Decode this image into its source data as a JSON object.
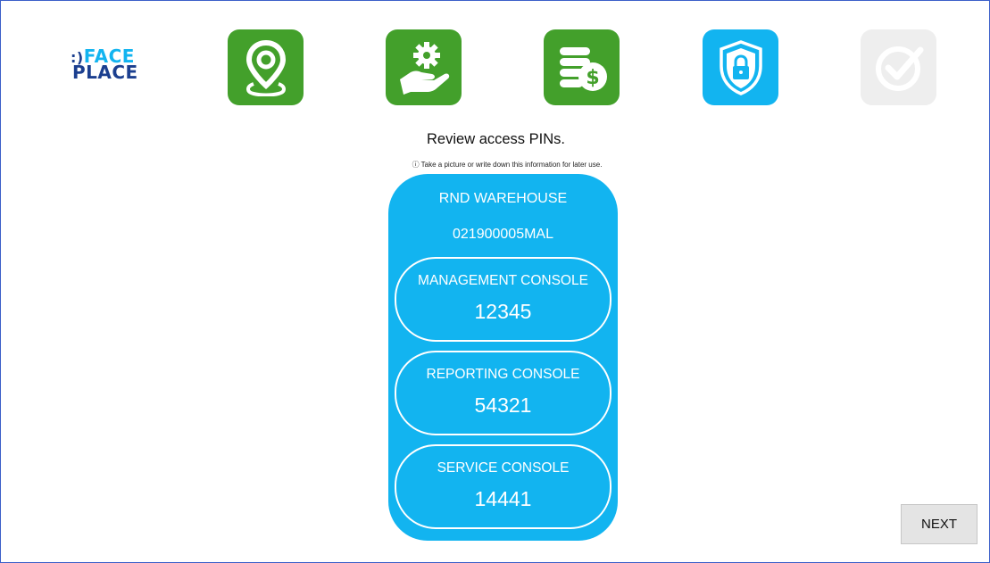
{
  "brand": {
    "logo_line1_prefix": ":)",
    "logo_line1": "FACE",
    "logo_line2": "PLACE"
  },
  "steps": [
    {
      "icon": "location-pin-icon",
      "state": "completed",
      "color": "#43a02b"
    },
    {
      "icon": "hand-gear-icon",
      "state": "completed",
      "color": "#43a02b"
    },
    {
      "icon": "coins-dollar-icon",
      "state": "completed",
      "color": "#43a02b"
    },
    {
      "icon": "shield-lock-icon",
      "state": "current",
      "color": "#12b4f0"
    },
    {
      "icon": "checkmark-icon",
      "state": "pending",
      "color": "#eeeeee"
    }
  ],
  "main": {
    "title": "Review access PINs.",
    "hint_icon": "ⓘ",
    "hint": "Take a picture or write down this information for later use."
  },
  "site": {
    "name": "RND WAREHOUSE",
    "code": "021900005MAL"
  },
  "pins": [
    {
      "label": "MANAGEMENT CONSOLE",
      "value": "12345"
    },
    {
      "label": "REPORTING CONSOLE",
      "value": "54321"
    },
    {
      "label": "SERVICE CONSOLE",
      "value": "14441"
    }
  ],
  "footer": {
    "next_label": "NEXT"
  },
  "colors": {
    "accent_blue": "#12b4f0",
    "step_green": "#43a02b",
    "step_disabled": "#eeeeee",
    "logo_navy": "#1b3f8f"
  }
}
